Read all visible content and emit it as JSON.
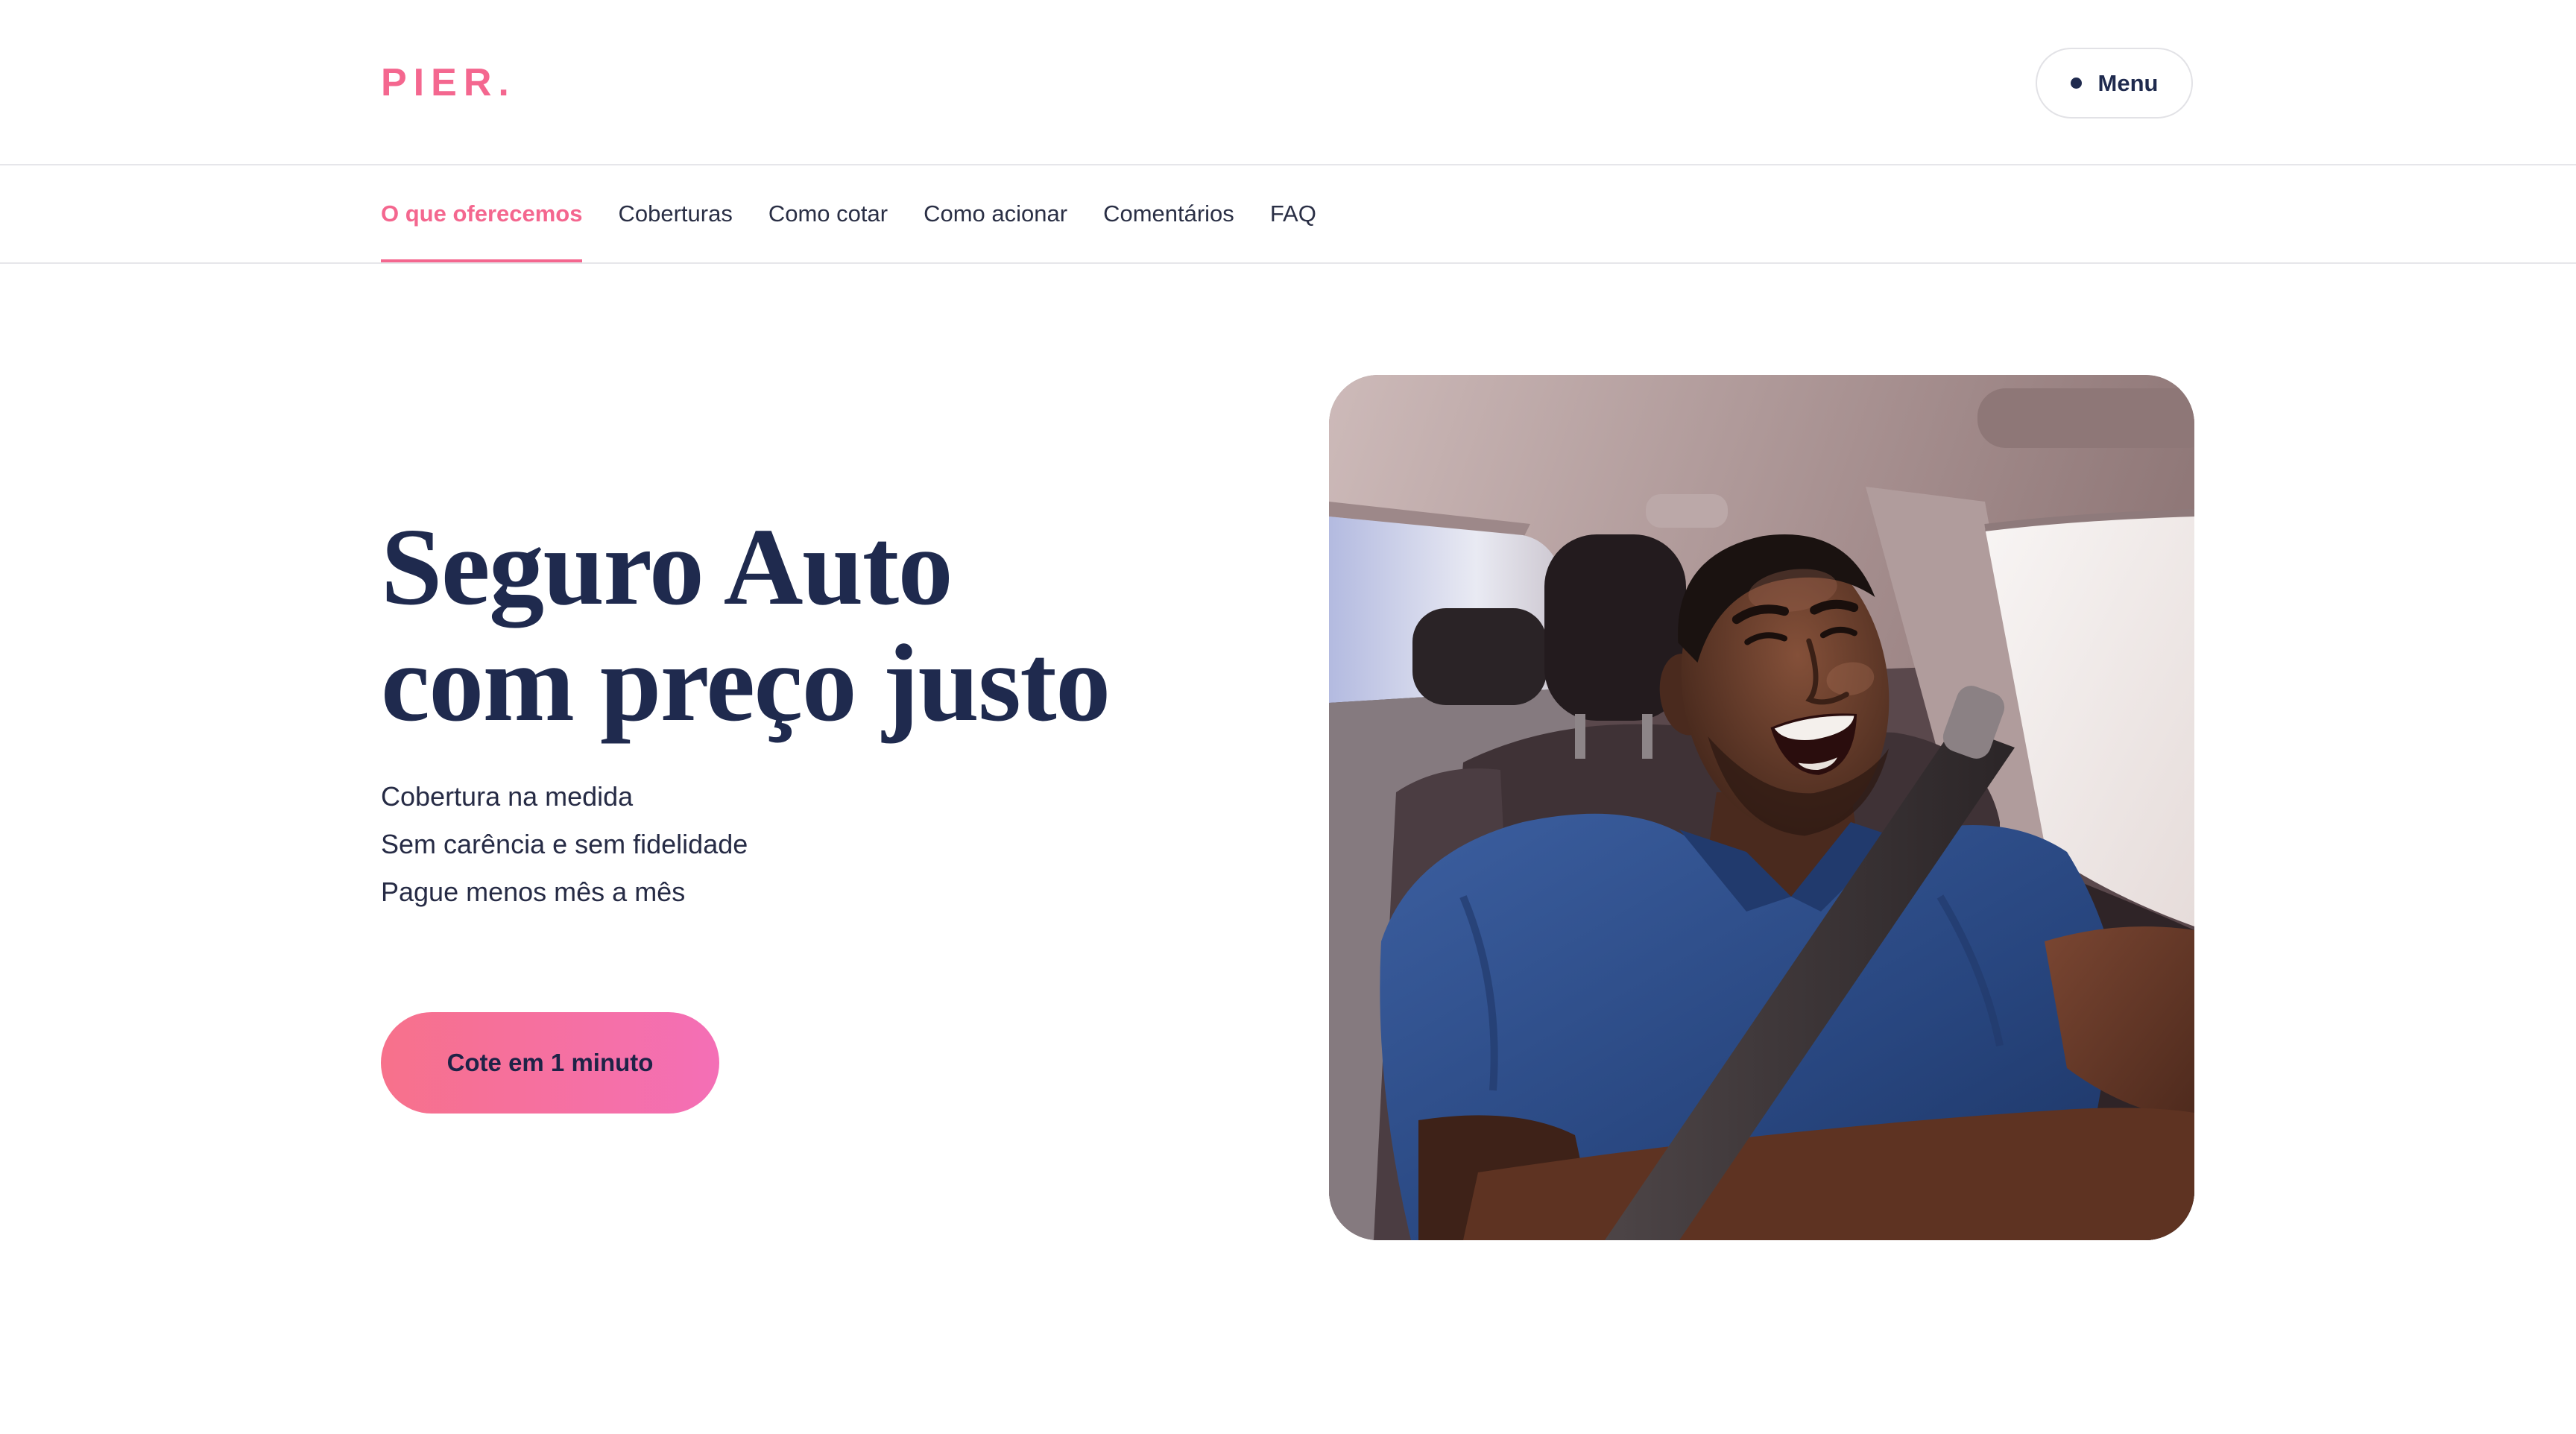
{
  "brand": {
    "logo_text": "PIER."
  },
  "header": {
    "menu_label": "Menu",
    "menu_icon": "dot-icon"
  },
  "nav": {
    "items": [
      {
        "label": "O que oferecemos",
        "active": true
      },
      {
        "label": "Coberturas",
        "active": false
      },
      {
        "label": "Como cotar",
        "active": false
      },
      {
        "label": "Como acionar",
        "active": false
      },
      {
        "label": "Comentários",
        "active": false
      },
      {
        "label": "FAQ",
        "active": false
      }
    ]
  },
  "hero": {
    "title_line_1": "Seguro Auto",
    "title_line_2": "com preço justo",
    "bullets": [
      "Cobertura na medida",
      "Sem carência e sem fidelidade",
      "Pague menos mês a mês"
    ],
    "cta_label": "Cote em 1 minuto"
  },
  "colors": {
    "accent": "#f4678f",
    "navy": "#1f2a4e",
    "text": "#262b45",
    "border": "#e6e6ea",
    "cta_start": "#f7718b",
    "cta_end": "#f46fb6"
  }
}
